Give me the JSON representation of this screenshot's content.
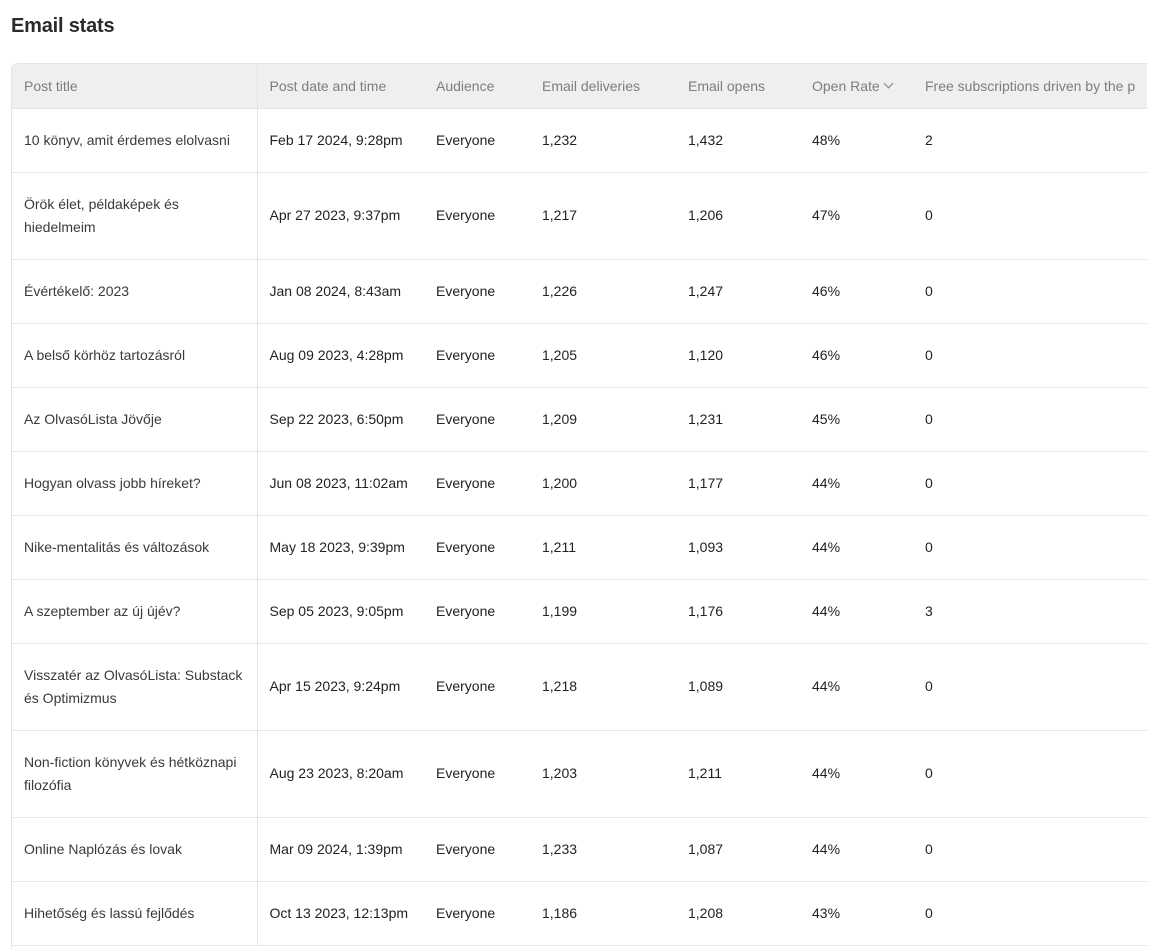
{
  "page": {
    "title": "Email stats"
  },
  "table": {
    "columns": [
      {
        "key": "title",
        "label": "Post title"
      },
      {
        "key": "date",
        "label": "Post date and time"
      },
      {
        "key": "audience",
        "label": "Audience"
      },
      {
        "key": "deliveries",
        "label": "Email deliveries"
      },
      {
        "key": "opens",
        "label": "Email opens"
      },
      {
        "key": "open_rate",
        "label": "Open Rate",
        "sorted": "descending"
      },
      {
        "key": "free_subs",
        "label": "Free subscriptions driven by the p"
      }
    ],
    "rows": [
      {
        "title": "10 könyv, amit érdemes elolvasni",
        "date": "Feb 17 2024, 9:28pm",
        "audience": "Everyone",
        "deliveries": "1,232",
        "opens": "1,432",
        "open_rate": "48%",
        "free_subs": "2"
      },
      {
        "title": "Örök élet, példaképek és hiedelmeim",
        "date": "Apr 27 2023, 9:37pm",
        "audience": "Everyone",
        "deliveries": "1,217",
        "opens": "1,206",
        "open_rate": "47%",
        "free_subs": "0"
      },
      {
        "title": "Évértékelő: 2023",
        "date": "Jan 08 2024, 8:43am",
        "audience": "Everyone",
        "deliveries": "1,226",
        "opens": "1,247",
        "open_rate": "46%",
        "free_subs": "0"
      },
      {
        "title": "A belső körhöz tartozásról",
        "date": "Aug 09 2023, 4:28pm",
        "audience": "Everyone",
        "deliveries": "1,205",
        "opens": "1,120",
        "open_rate": "46%",
        "free_subs": "0"
      },
      {
        "title": "Az OlvasóLista Jövője",
        "date": "Sep 22 2023, 6:50pm",
        "audience": "Everyone",
        "deliveries": "1,209",
        "opens": "1,231",
        "open_rate": "45%",
        "free_subs": "0"
      },
      {
        "title": "Hogyan olvass jobb híreket?",
        "date": "Jun 08 2023, 11:02am",
        "audience": "Everyone",
        "deliveries": "1,200",
        "opens": "1,177",
        "open_rate": "44%",
        "free_subs": "0"
      },
      {
        "title": "Nike-mentalitás és változások",
        "date": "May 18 2023, 9:39pm",
        "audience": "Everyone",
        "deliveries": "1,211",
        "opens": "1,093",
        "open_rate": "44%",
        "free_subs": "0"
      },
      {
        "title": "A szeptember az új újév?",
        "date": "Sep 05 2023, 9:05pm",
        "audience": "Everyone",
        "deliveries": "1,199",
        "opens": "1,176",
        "open_rate": "44%",
        "free_subs": "3"
      },
      {
        "title": "Visszatér az OlvasóLista: Substack és Optimizmus",
        "date": "Apr 15 2023, 9:24pm",
        "audience": "Everyone",
        "deliveries": "1,218",
        "opens": "1,089",
        "open_rate": "44%",
        "free_subs": "0"
      },
      {
        "title": "Non-fiction könyvek és hétköznapi filozófia",
        "date": "Aug 23 2023, 8:20am",
        "audience": "Everyone",
        "deliveries": "1,203",
        "opens": "1,211",
        "open_rate": "44%",
        "free_subs": "0"
      },
      {
        "title": "Online Naplózás és lovak",
        "date": "Mar 09 2024, 1:39pm",
        "audience": "Everyone",
        "deliveries": "1,233",
        "opens": "1,087",
        "open_rate": "44%",
        "free_subs": "0"
      },
      {
        "title": "Hihetőség és lassú fejlődés",
        "date": "Oct 13 2023, 12:13pm",
        "audience": "Everyone",
        "deliveries": "1,186",
        "opens": "1,208",
        "open_rate": "43%",
        "free_subs": "0"
      }
    ]
  }
}
